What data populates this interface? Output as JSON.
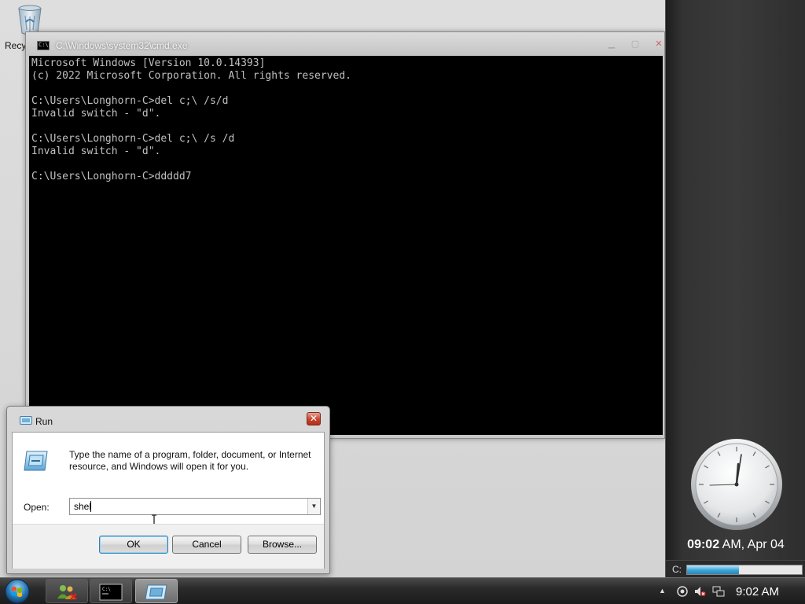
{
  "desktop": {
    "icons": [
      {
        "label": "Recy",
        "icon": "recycle-bin-icon"
      }
    ]
  },
  "cmd": {
    "title": "C:\\Windows\\system32\\cmd.exe",
    "icon": "console-icon",
    "lines": [
      "Microsoft Windows [Version 10.0.14393]",
      "(c) 2022 Microsoft Corporation. All rights reserved.",
      "",
      "C:\\Users\\Longhorn-C>del c;\\ /s/d",
      "Invalid switch - \"d\".",
      "",
      "C:\\Users\\Longhorn-C>del c;\\ /s /d",
      "Invalid switch - \"d\".",
      "",
      "C:\\Users\\Longhorn-C>ddddd7"
    ],
    "colors": {
      "background": "#000000",
      "text": "#c0c0c0"
    }
  },
  "run": {
    "title": "Run",
    "close_glyph": "✕",
    "description": "Type the name of a program, folder, document, or Internet resource, and Windows will open it for you.",
    "open_label": "Open:",
    "input_value": "shel",
    "buttons": {
      "ok": "OK",
      "cancel": "Cancel",
      "browse": "Browse..."
    }
  },
  "sidebar": {
    "clock": {
      "time_bold": "09:02",
      "time_rest": " AM, Apr 04"
    },
    "drive": {
      "label": "C:",
      "used_fraction": 0.45
    }
  },
  "taskbar": {
    "items": [
      {
        "name": "users-network-icon",
        "active": false
      },
      {
        "name": "console-icon",
        "active": false
      },
      {
        "name": "run-icon",
        "active": true
      }
    ],
    "tray": {
      "time": "9:02 AM",
      "icons": [
        "show-hidden-icons-arrow",
        "security-icon",
        "volume-muted-icon",
        "network-icon"
      ]
    }
  },
  "colors": {
    "accent": "#3ba4d6",
    "close_red": "#c9432d"
  }
}
